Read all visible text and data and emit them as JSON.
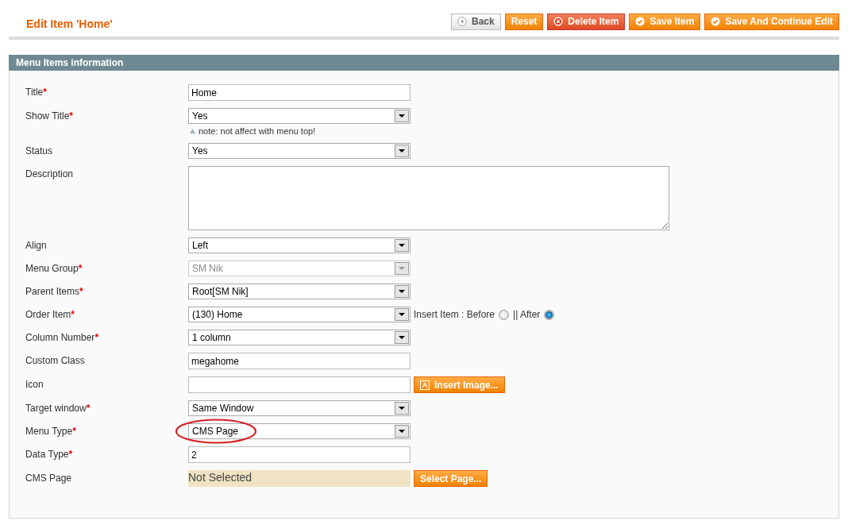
{
  "page_title": "Edit Item 'Home'",
  "buttons": [
    {
      "label": "Back",
      "kind": "back"
    },
    {
      "label": "Reset",
      "kind": "plain"
    },
    {
      "label": "Delete Item",
      "kind": "delete"
    },
    {
      "label": "Save Item",
      "kind": "save"
    },
    {
      "label": "Save And Continue Edit",
      "kind": "save"
    }
  ],
  "section": {
    "title": "Menu Items information",
    "fields": [
      {
        "label": "Title",
        "required_mark": "*",
        "kind": "text",
        "value": "Home"
      },
      {
        "label": "Show Title",
        "required_mark": "*",
        "kind": "select",
        "value": "Yes",
        "note": "note: not affect with menu top!"
      },
      {
        "label": "Status",
        "kind": "select",
        "value": "Yes"
      },
      {
        "label": "Description",
        "kind": "textarea"
      },
      {
        "label": "Align",
        "kind": "select",
        "value": "Left"
      },
      {
        "label": "Menu Group",
        "required_mark": "*",
        "kind": "select",
        "value": "SM Nik",
        "disabled": true
      },
      {
        "label": "Parent Items",
        "required_mark": "*",
        "kind": "select",
        "value": "Root[SM Nik]"
      },
      {
        "label": "Order Item",
        "required_mark": "*",
        "kind": "select",
        "value": "(130) Home",
        "extras": [
          {
            "kind": "text",
            "text": "Insert Item : Before"
          },
          {
            "kind": "radio",
            "selected": false
          },
          {
            "kind": "text",
            "text": "|| After"
          },
          {
            "kind": "radio",
            "selected": true
          }
        ]
      },
      {
        "label": "Column Number",
        "required_mark": "*",
        "kind": "select",
        "value": "1 column"
      },
      {
        "label": "Custom Class",
        "kind": "text",
        "value": "megahome"
      },
      {
        "label": "Icon",
        "kind": "text",
        "extras": [
          {
            "kind": "button",
            "text": "Insert Image..."
          }
        ]
      },
      {
        "label": "Target window",
        "required_mark": "*",
        "kind": "select",
        "value": "Same Window"
      },
      {
        "label": "Menu Type",
        "required_mark": "*",
        "kind": "select",
        "value": "CMS Page",
        "circled": true
      },
      {
        "label": "Data Type",
        "required_mark": "*",
        "kind": "text",
        "value": "2"
      },
      {
        "label": "CMS Page",
        "kind": "picker",
        "value": "Not Selected",
        "extras": [
          {
            "kind": "button",
            "text": "Select Page..."
          }
        ]
      }
    ]
  }
}
